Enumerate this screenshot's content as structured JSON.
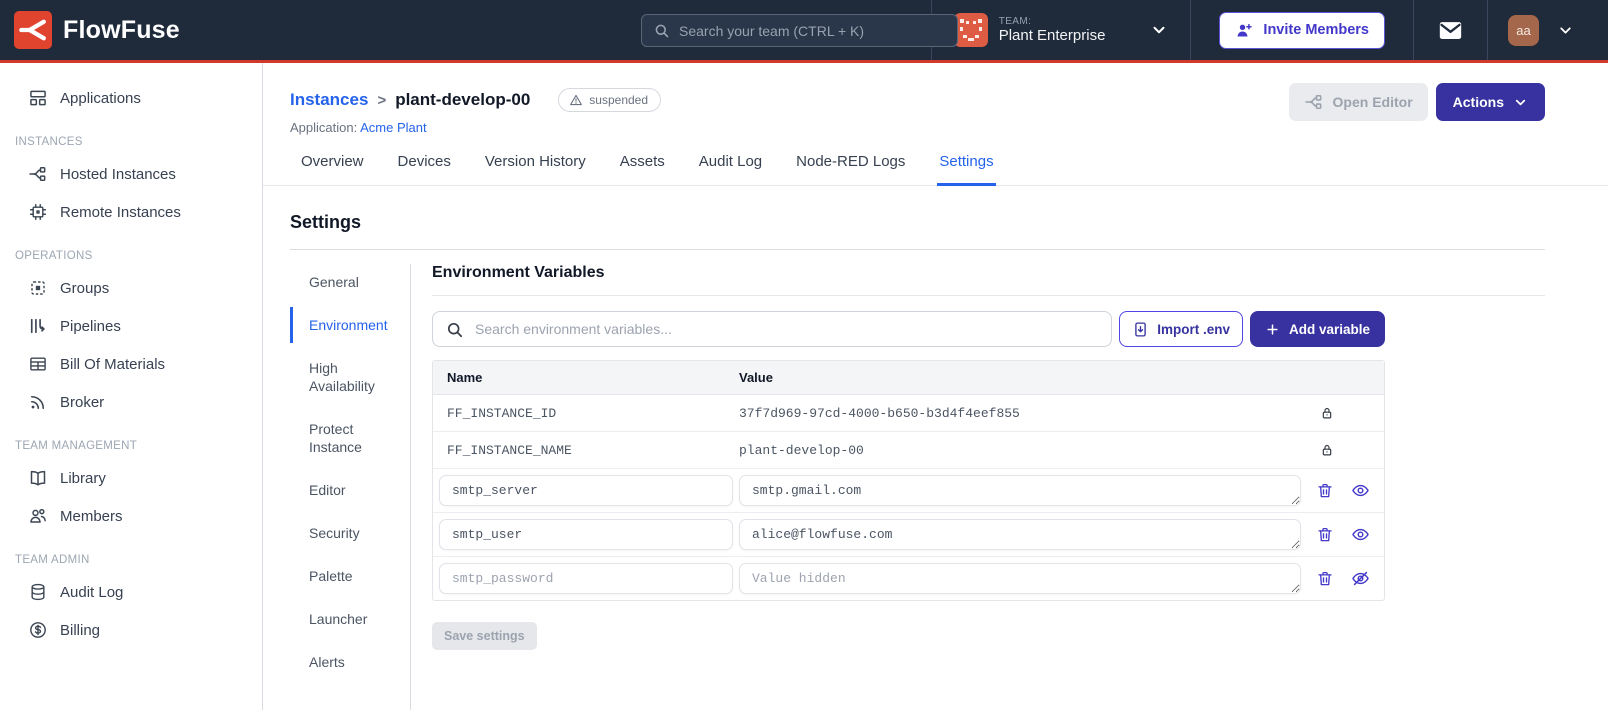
{
  "colors": {
    "navbar_bg": "#1F2A3A",
    "accent_red": "#CF3A2D",
    "logo_red": "#E0432E",
    "brand_indigo": "#37329F",
    "link_blue": "#2563EB",
    "user_avatar_bg": "#A4674B",
    "team_avatar_bg": "#DE5C43"
  },
  "navbar": {
    "brand": "FlowFuse",
    "search_placeholder": "Search your team (CTRL + K)",
    "team_label": "TEAM:",
    "team_name": "Plant Enterprise",
    "invite_button": "Invite Members",
    "avatar_initials": "aa",
    "icons": [
      "search-icon",
      "chevron-down-icon",
      "invite-members-icon",
      "mail-icon"
    ]
  },
  "sidebar": {
    "top_items": [
      {
        "label": "Applications",
        "icon": "applications-icon"
      }
    ],
    "sections": [
      {
        "title": "INSTANCES",
        "items": [
          {
            "label": "Hosted Instances",
            "icon": "hosted-instances-icon"
          },
          {
            "label": "Remote Instances",
            "icon": "remote-instances-icon"
          }
        ]
      },
      {
        "title": "OPERATIONS",
        "items": [
          {
            "label": "Groups",
            "icon": "groups-icon"
          },
          {
            "label": "Pipelines",
            "icon": "pipelines-icon"
          },
          {
            "label": "Bill Of Materials",
            "icon": "bill-of-materials-icon"
          },
          {
            "label": "Broker",
            "icon": "broker-icon"
          }
        ]
      },
      {
        "title": "TEAM MANAGEMENT",
        "items": [
          {
            "label": "Library",
            "icon": "library-icon"
          },
          {
            "label": "Members",
            "icon": "members-icon"
          }
        ]
      },
      {
        "title": "TEAM ADMIN",
        "items": [
          {
            "label": "Audit Log",
            "icon": "audit-log-icon"
          },
          {
            "label": "Billing",
            "icon": "billing-icon"
          }
        ]
      }
    ]
  },
  "header": {
    "breadcrumb": "Instances",
    "separator": ">",
    "instance_name": "plant-develop-00",
    "status_badge": "suspended",
    "application_label": "Application:",
    "application_name": "Acme Plant",
    "open_editor_button": "Open Editor",
    "actions_button": "Actions"
  },
  "tabs": [
    {
      "label": "Overview",
      "active": false
    },
    {
      "label": "Devices",
      "active": false
    },
    {
      "label": "Version History",
      "active": false
    },
    {
      "label": "Assets",
      "active": false
    },
    {
      "label": "Audit Log",
      "active": false
    },
    {
      "label": "Node-RED Logs",
      "active": false
    },
    {
      "label": "Settings",
      "active": true
    }
  ],
  "settings": {
    "title": "Settings",
    "nav": [
      {
        "label": "General",
        "active": false
      },
      {
        "label": "Environment",
        "active": true
      },
      {
        "label": "High Availability",
        "active": false
      },
      {
        "label": "Protect Instance",
        "active": false
      },
      {
        "label": "Editor",
        "active": false
      },
      {
        "label": "Security",
        "active": false
      },
      {
        "label": "Palette",
        "active": false
      },
      {
        "label": "Launcher",
        "active": false
      },
      {
        "label": "Alerts",
        "active": false
      }
    ],
    "section_title": "Environment Variables",
    "search_placeholder": "Search environment variables...",
    "import_button": "Import .env",
    "add_button": "Add variable",
    "table": {
      "name_column": "Name",
      "value_column": "Value",
      "locked_rows": [
        {
          "name": "FF_INSTANCE_ID",
          "value": "37f7d969-97cd-4000-b650-b3d4f4eef855"
        },
        {
          "name": "FF_INSTANCE_NAME",
          "value": "plant-develop-00"
        }
      ],
      "editable_rows": [
        {
          "name": "smtp_server",
          "value": "smtp.gmail.com",
          "hidden": false
        },
        {
          "name": "smtp_user",
          "value": "alice@flowfuse.com",
          "hidden": false
        },
        {
          "name": "smtp_password",
          "value": "",
          "value_placeholder": "Value hidden",
          "hidden": true
        }
      ]
    },
    "save_button": "Save settings"
  }
}
